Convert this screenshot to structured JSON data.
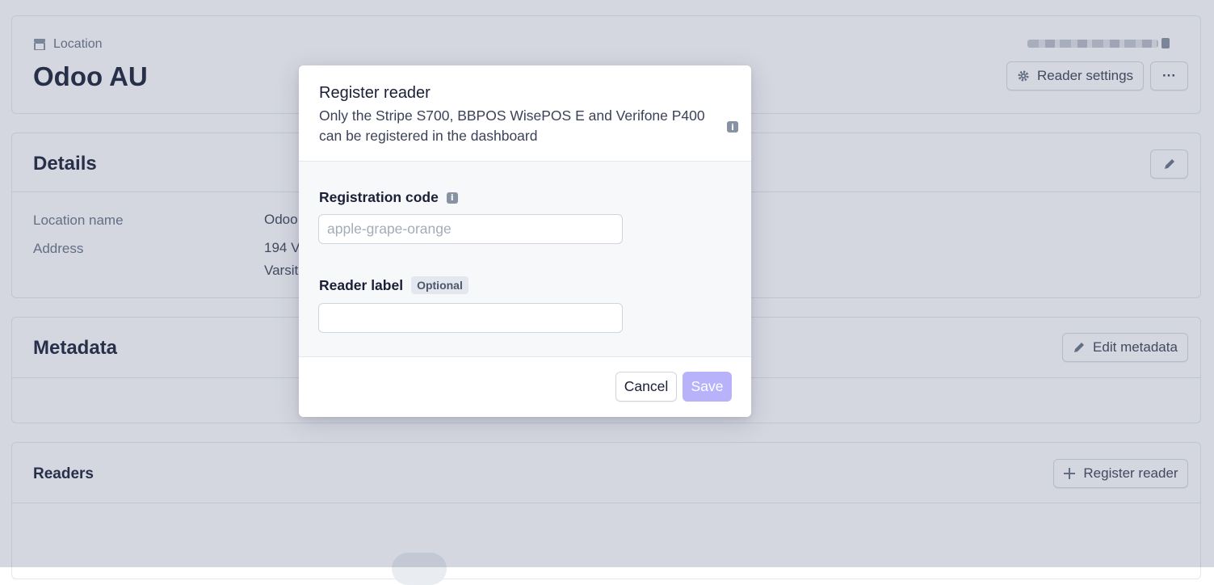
{
  "location_card": {
    "kicker": "Location",
    "title": "Odoo AU",
    "reader_settings_label": "Reader settings",
    "more_label": "···"
  },
  "details": {
    "title": "Details",
    "rows": [
      {
        "label": "Location name",
        "value": "Odoo"
      },
      {
        "label": "Address",
        "value_line1": "194 V",
        "value_line2": "Varsit"
      }
    ]
  },
  "metadata": {
    "title": "Metadata",
    "edit_label": "Edit metadata"
  },
  "readers": {
    "title": "Readers",
    "register_label": "Register reader"
  },
  "modal": {
    "title": "Register reader",
    "description": "Only the Stripe S700, BBPOS WisePOS E and Verifone P400 can be registered in the dashboard",
    "registration_code_label": "Registration code",
    "registration_code_placeholder": "apple-grape-orange",
    "registration_code_value": "",
    "reader_label_label": "Reader label",
    "optional_badge": "Optional",
    "reader_label_value": "",
    "cancel_label": "Cancel",
    "save_label": "Save",
    "info_glyph": "i"
  },
  "colors": {
    "accent_disabled": "#b8b2fb",
    "overlay": "rgba(82,95,127,0.25)",
    "text_primary": "#1a1f36",
    "text_secondary": "#697386"
  },
  "icons": [
    "store-icon",
    "gear-icon",
    "more-icon",
    "pencil-icon",
    "plus-icon",
    "info-icon",
    "clipboard-icon"
  ]
}
